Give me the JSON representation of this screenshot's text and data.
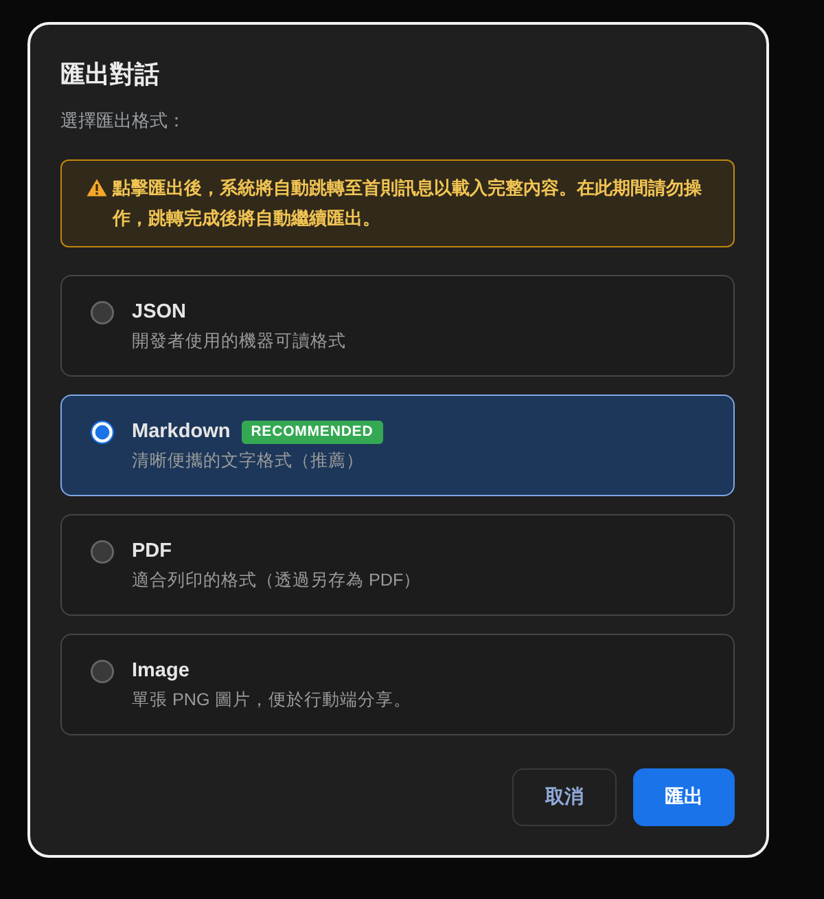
{
  "dialog": {
    "title": "匯出對話",
    "subtitle": "選擇匯出格式：",
    "warning": "點擊匯出後，系統將自動跳轉至首則訊息以載入完整內容。在此期間請勿操作，跳轉完成後將自動繼續匯出。"
  },
  "options": [
    {
      "label": "JSON",
      "description": "開發者使用的機器可讀格式",
      "selected": false
    },
    {
      "label": "Markdown",
      "badge": "RECOMMENDED",
      "description": "清晰便攜的文字格式（推薦）",
      "selected": true
    },
    {
      "label": "PDF",
      "description": "適合列印的格式（透過另存為 PDF）",
      "selected": false
    },
    {
      "label": "Image",
      "description": "單張 PNG 圖片，便於行動端分享。",
      "selected": false
    }
  ],
  "buttons": [
    {
      "label": "取消",
      "kind": "secondary"
    },
    {
      "label": "匯出",
      "kind": "primary"
    }
  ]
}
